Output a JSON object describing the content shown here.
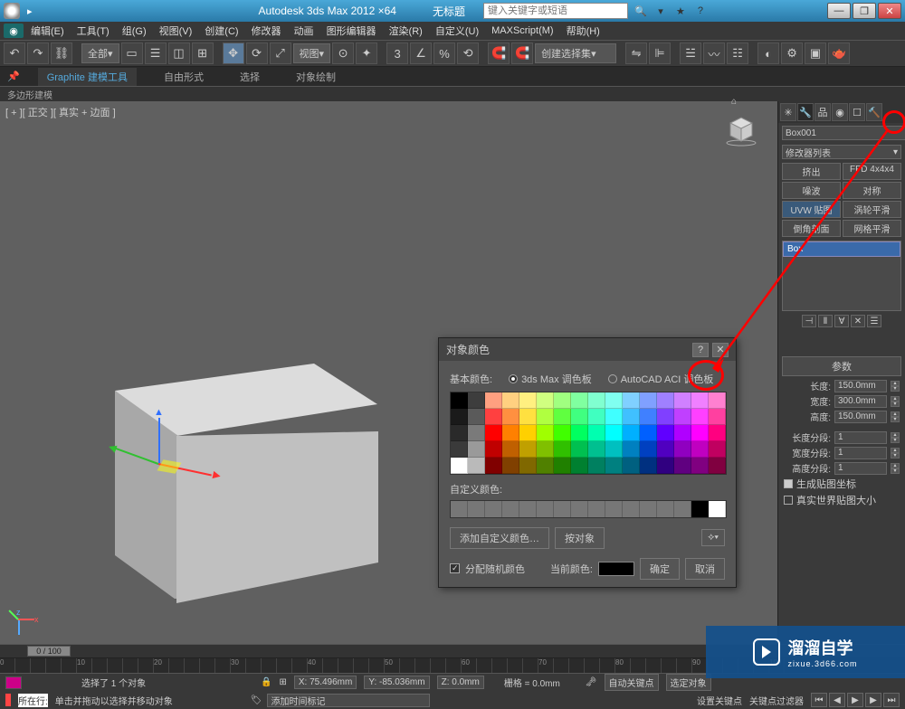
{
  "titlebar": {
    "app": "Autodesk 3ds Max 2012 ×64",
    "document": "无标题",
    "search_placeholder": "键入关键字或短语"
  },
  "menu": [
    "编辑(E)",
    "工具(T)",
    "组(G)",
    "视图(V)",
    "创建(C)",
    "修改器",
    "动画",
    "图形编辑器",
    "渲染(R)",
    "自定义(U)",
    "MAXScript(M)",
    "帮助(H)"
  ],
  "toolbar": {
    "selset_drop": "全部",
    "view_drop": "视图",
    "named_sel": "创建选择集"
  },
  "ribbon": {
    "tabs": [
      "Graphite 建模工具",
      "自由形式",
      "选择",
      "对象绘制"
    ],
    "sub": "多边形建模"
  },
  "viewport": {
    "label": "[ + ][ 正交 ][ 真实 + 边面 ]"
  },
  "dialog": {
    "title": "对象颜色",
    "basic_label": "基本颜色:",
    "radio1": "3ds Max 调色板",
    "radio2": "AutoCAD ACI 调色板",
    "custom_label": "自定义颜色:",
    "add_custom": "添加自定义颜色…",
    "byobject": "按对象",
    "random": "分配随机颜色",
    "current": "当前颜色:",
    "ok": "确定",
    "cancel": "取消",
    "palette_colors": [
      "#000000",
      "#3d3d3d",
      "#ffa080",
      "#ffd080",
      "#fff080",
      "#d0ff80",
      "#a0ff80",
      "#80ffa0",
      "#80ffd0",
      "#80fff0",
      "#80d0ff",
      "#80a0ff",
      "#a080ff",
      "#d080ff",
      "#f080ff",
      "#ff80d0",
      "#1a1a1a",
      "#5a5a5a",
      "#ff4040",
      "#ff9040",
      "#ffe040",
      "#b0ff40",
      "#60ff40",
      "#40ff80",
      "#40ffc0",
      "#40ffff",
      "#40c0ff",
      "#4080ff",
      "#8040ff",
      "#c040ff",
      "#ff40ff",
      "#ff40a0",
      "#2a2a2a",
      "#7a7a7a",
      "#ff0000",
      "#ff8000",
      "#ffd000",
      "#a0ff00",
      "#40ff00",
      "#00ff60",
      "#00ffb0",
      "#00ffff",
      "#00b0ff",
      "#0060ff",
      "#6000ff",
      "#b000ff",
      "#ff00ff",
      "#ff0080",
      "#3a3a3a",
      "#9a9a9a",
      "#c00000",
      "#c06000",
      "#c0a000",
      "#80c000",
      "#30c000",
      "#00c050",
      "#00c090",
      "#00c0c0",
      "#0080c0",
      "#0040c0",
      "#5000c0",
      "#9000c0",
      "#c000c0",
      "#c00060",
      "#ffffff",
      "#bababa",
      "#800000",
      "#804000",
      "#806800",
      "#508000",
      "#208000",
      "#008030",
      "#008060",
      "#008080",
      "#006080",
      "#003080",
      "#300080",
      "#600080",
      "#800080",
      "#800040"
    ]
  },
  "right": {
    "objname": "Box001",
    "modlist": "修改器列表",
    "modbtns": [
      [
        "挤出",
        "FFD 4x4x4"
      ],
      [
        "噪波",
        "对称"
      ],
      [
        "UVW 贴图",
        "涡轮平滑"
      ],
      [
        "倒角剖面",
        "网格平滑"
      ]
    ],
    "stackitem": "Box",
    "rollout": "参数",
    "params": {
      "length_l": "长度:",
      "length_v": "150.0mm",
      "width_l": "宽度:",
      "width_v": "300.0mm",
      "height_l": "高度:",
      "height_v": "150.0mm",
      "lseg_l": "长度分段:",
      "lseg_v": "1",
      "wseg_l": "宽度分段:",
      "wseg_v": "1",
      "hseg_l": "高度分段:",
      "hseg_v": "1",
      "genmap": "生成贴图坐标",
      "realworld": "真实世界贴图大小"
    }
  },
  "timeslider": "0 / 100",
  "status": {
    "sel": "选择了 1 个对象",
    "x": "X: 75.496mm",
    "y": "Y: -85.036mm",
    "z": "Z: 0.0mm",
    "grid": "栅格 = 0.0mm",
    "autokey": "自动关键点",
    "selkey": "选定对象",
    "prompt": "单击并拖动以选择并移动对象",
    "addtime": "添加时间标记",
    "setkey": "设置关键点",
    "keyfilter": "关键点过滤器"
  },
  "row2": {
    "tag": "所在行:"
  },
  "watermark": {
    "big": "溜溜自学",
    "sm": "zixue.3d66.com"
  }
}
